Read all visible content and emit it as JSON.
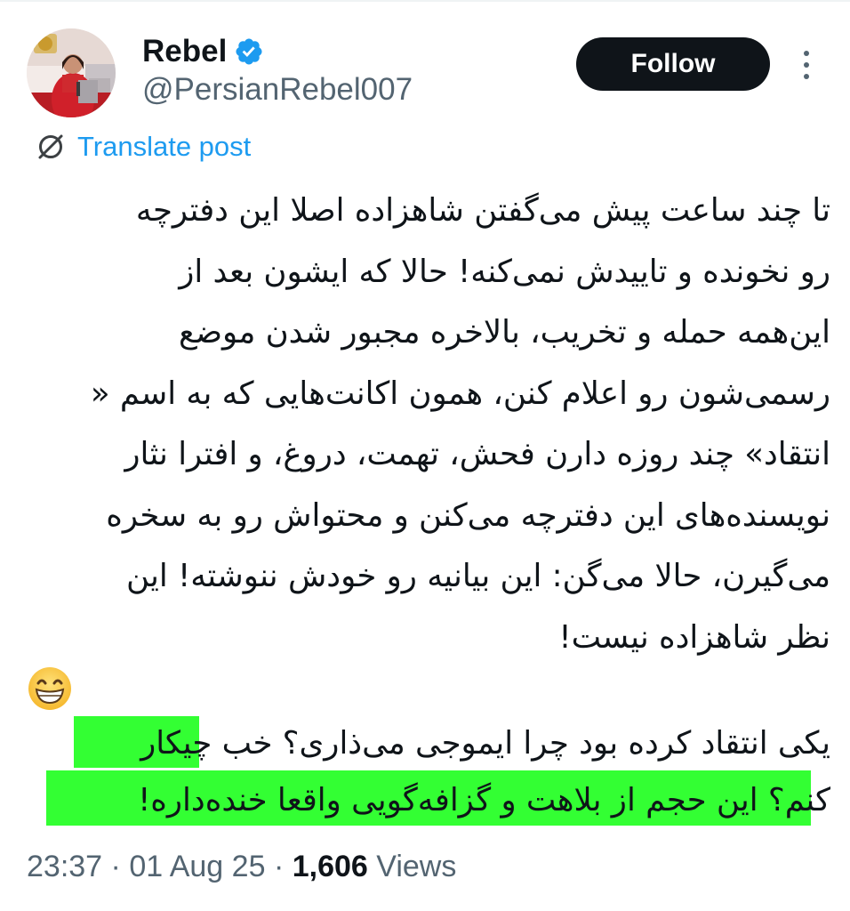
{
  "author": {
    "display_name": "Rebel",
    "handle": "@PersianRebel007",
    "verified_icon": "verified-badge-icon",
    "verified_color": "#1d9bf0"
  },
  "actions": {
    "follow_label": "Follow",
    "more_icon": "more-vertical-icon"
  },
  "translate": {
    "label": "Translate post",
    "icon": "translate-icon",
    "color": "#1d9bf0"
  },
  "post": {
    "lines": [
      "تا چند ساعت پیش می‌گفتن شاهزاده اصلا این دفترچه",
      "رو نخونده و تاییدش نمی‌کنه! حالا که ایشون بعد از",
      "این‌همه حمله و تخریب، بالاخره مجبور شدن موضع",
      "رسمی‌شون رو اعلام کنن، همون اکانت‌هایی که به اسم «",
      "انتقاد» چند روزه دارن فحش، تهمت، دروغ، و افترا نثار",
      "نویسنده‌های این دفترچه می‌کنن و محتواش رو به سخره",
      "می‌گیرن، حالا می‌گن: این بیانیه رو خودش ننوشته! این",
      "نظر شاهزاده نیست!"
    ],
    "emoji": "grinning-face-icon",
    "lines2": [
      "یکی  انتقاد کرده بود چرا ایموجی می‌ذاری؟ خب چیکار",
      "کنم؟ این حجم از بلاهت و گزافه‌گویی واقعا خنده‌داره!"
    ],
    "highlight_color": "#33ff33"
  },
  "meta": {
    "time": "23:37",
    "separator": "·",
    "date": "01 Aug 25",
    "views_count": "1,606",
    "views_label": "Views"
  }
}
